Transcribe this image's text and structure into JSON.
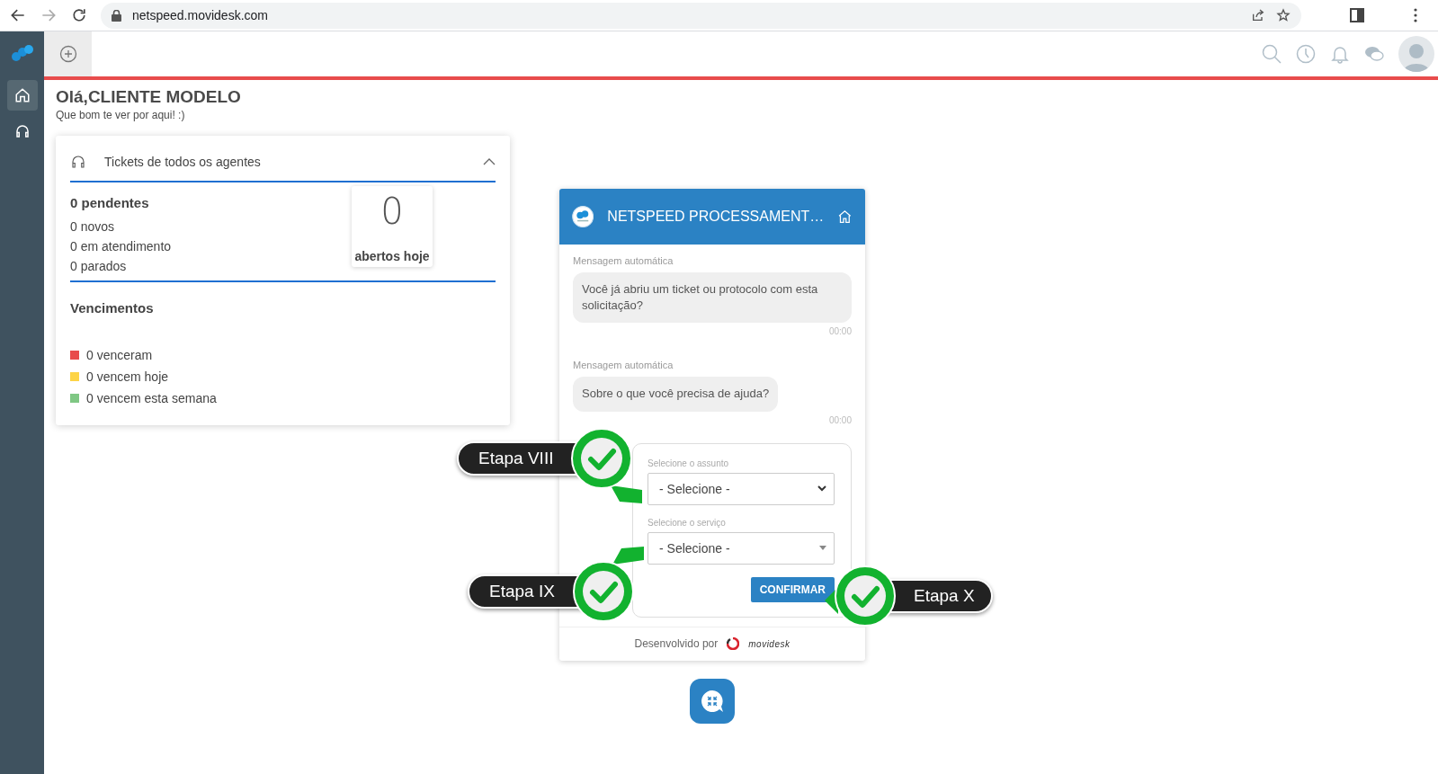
{
  "browser": {
    "url": "netspeed.movidesk.com"
  },
  "sidebar": {
    "items": [
      {
        "kind": "home",
        "selected": true
      },
      {
        "kind": "headset",
        "selected": false
      }
    ]
  },
  "greeting": {
    "title": "Olá,CLIENTE MODELO",
    "subtitle": "Que bom te ver por aqui! :)"
  },
  "tickets_card": {
    "title": "Tickets de todos os agentes",
    "expanded": true,
    "pending": "0 pendentes",
    "counts": [
      "0 novos",
      "0 em atendimento",
      "0 parados"
    ],
    "today": {
      "value": "0",
      "label": "abertos hoje"
    },
    "due_title": "Vencimentos",
    "due": [
      {
        "label": "0 venceram",
        "color": "#e84c4c"
      },
      {
        "label": "0 vencem hoje",
        "color": "#fdd446"
      },
      {
        "label": "0 vencem esta semana",
        "color": "#7fc784"
      }
    ]
  },
  "chat": {
    "title": "NETSPEED PROCESSAMENT…",
    "messages": [
      {
        "sender": "Mensagem automática",
        "text": "Você já abriu um ticket ou protocolo com esta solicitação?",
        "time": "00:00"
      },
      {
        "sender": "Mensagem automática",
        "text": "Sobre o que você precisa de ajuda?",
        "time": "00:00"
      }
    ],
    "form": {
      "fields": [
        {
          "label": "Selecione o assunto",
          "value": "- Selecione -",
          "kind": "native"
        },
        {
          "label": "Selecione o serviço",
          "value": "- Selecione -",
          "kind": "custom"
        }
      ],
      "button": "CONFIRMAR"
    },
    "footer": "Desenvolvido por",
    "brand": "movidesk"
  },
  "callouts": [
    {
      "label": "Etapa VIII"
    },
    {
      "label": "Etapa IX"
    },
    {
      "label": "Etapa X"
    }
  ]
}
